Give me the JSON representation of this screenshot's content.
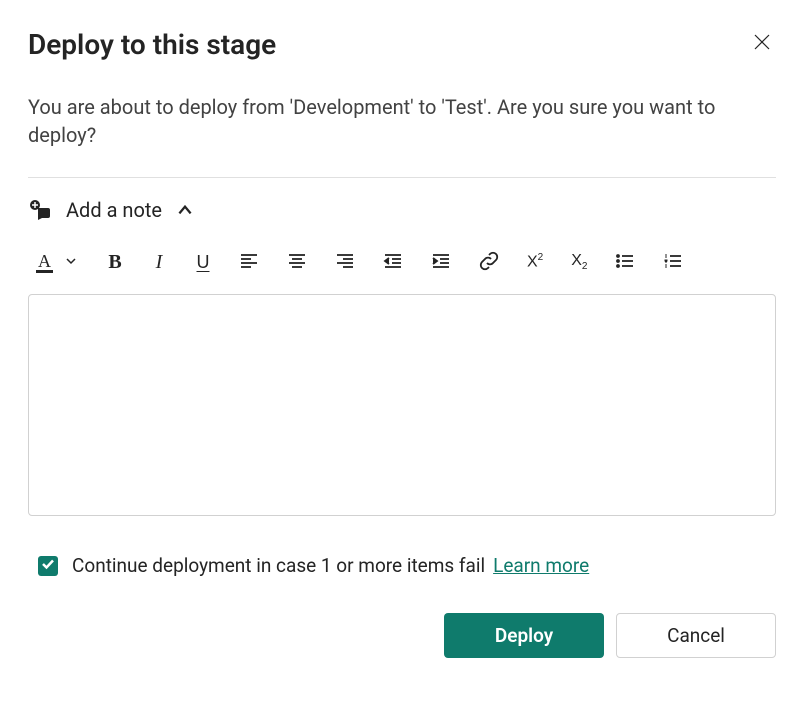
{
  "dialog": {
    "title": "Deploy to this stage",
    "description": "You are about to deploy from 'Development' to 'Test'. Are you sure you want to deploy?"
  },
  "note": {
    "label": "Add a note"
  },
  "editor": {
    "value": ""
  },
  "checkbox": {
    "checked": true,
    "label": "Continue deployment in case 1 or more items fail",
    "learn_more": "Learn more"
  },
  "footer": {
    "deploy": "Deploy",
    "cancel": "Cancel"
  },
  "toolbar": {
    "font_color": "A",
    "bold": "B",
    "italic": "I",
    "underline": "U"
  }
}
